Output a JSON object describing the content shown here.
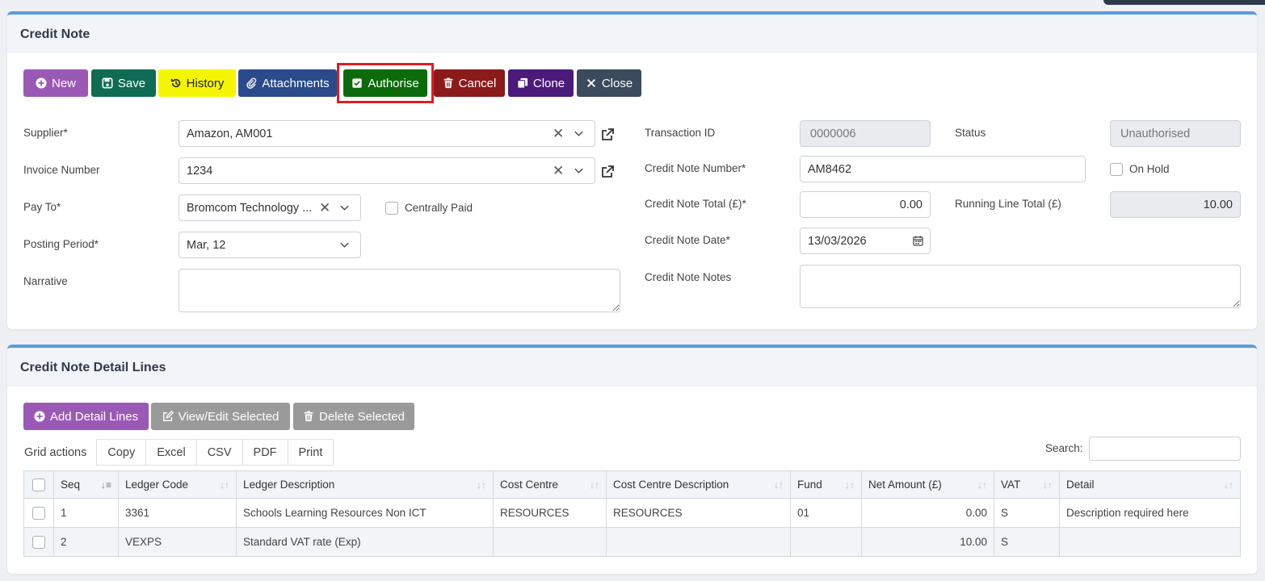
{
  "credit_note_panel": {
    "title": "Credit Note",
    "toolbar": {
      "new": "New",
      "save": "Save",
      "history": "History",
      "attachments": "Attachments",
      "authorise": "Authorise",
      "cancel": "Cancel",
      "clone": "Clone",
      "close": "Close"
    },
    "supplier": {
      "label": "Supplier*",
      "value": "Amazon, AM001"
    },
    "invoice_number": {
      "label": "Invoice Number",
      "value": "1234"
    },
    "pay_to": {
      "label": "Pay To*",
      "value": "Bromcom Technology ..."
    },
    "centrally_paid": {
      "label": "Centrally Paid"
    },
    "posting_period": {
      "label": "Posting Period*",
      "value": "Mar, 12"
    },
    "narrative": {
      "label": "Narrative",
      "value": ""
    },
    "transaction_id": {
      "label": "Transaction ID",
      "value": "0000006"
    },
    "status": {
      "label": "Status",
      "value": "Unauthorised"
    },
    "credit_note_number": {
      "label": "Credit Note Number*",
      "value": "AM8462"
    },
    "on_hold": {
      "label": "On Hold"
    },
    "credit_note_total": {
      "label": "Credit Note Total (£)*",
      "value": "0.00"
    },
    "running_line_total": {
      "label": "Running Line Total (£)",
      "value": "10.00"
    },
    "credit_note_date": {
      "label": "Credit Note Date*",
      "value": "13/03/2026"
    },
    "credit_note_notes": {
      "label": "Credit Note Notes",
      "value": ""
    }
  },
  "detail_panel": {
    "title": "Credit Note Detail Lines",
    "add_detail_lines": "Add Detail Lines",
    "view_edit_selected": "View/Edit Selected",
    "delete_selected": "Delete Selected",
    "grid_actions_label": "Grid actions",
    "grid_actions": [
      "Copy",
      "Excel",
      "CSV",
      "PDF",
      "Print"
    ],
    "search_label": "Search:",
    "columns": [
      "Seq",
      "Ledger Code",
      "Ledger Description",
      "Cost Centre",
      "Cost Centre Description",
      "Fund",
      "Net Amount (£)",
      "VAT",
      "Detail"
    ],
    "rows": [
      [
        "1",
        "3361",
        "Schools Learning Resources Non ICT",
        "RESOURCES",
        "RESOURCES",
        "01",
        "0.00",
        "S",
        "Description required here"
      ],
      [
        "2",
        "VEXPS",
        "Standard VAT rate (Exp)",
        "",
        "",
        "",
        "10.00",
        "S",
        ""
      ]
    ]
  },
  "colors": {
    "new": "#9b59b6",
    "save": "#0f6b54",
    "history": "#f5f500",
    "attachments": "#2a4a8c",
    "authorise": "#0b6b0b",
    "authorise_highlight": "#e11b22",
    "cancel": "#8b1a1a",
    "clone": "#4b1a7a",
    "close": "#3b4a5c",
    "panel_accent": "#5b9bdf",
    "add_detail": "#9b59b6",
    "disabled": "#9a9a9a"
  },
  "icons": {
    "new": "plus-circle-icon",
    "save": "floppy-icon",
    "history": "history-icon",
    "attachments": "paperclip-icon",
    "authorise": "check-square-icon",
    "cancel": "trash-icon",
    "clone": "copy-icon",
    "close": "x-icon"
  }
}
